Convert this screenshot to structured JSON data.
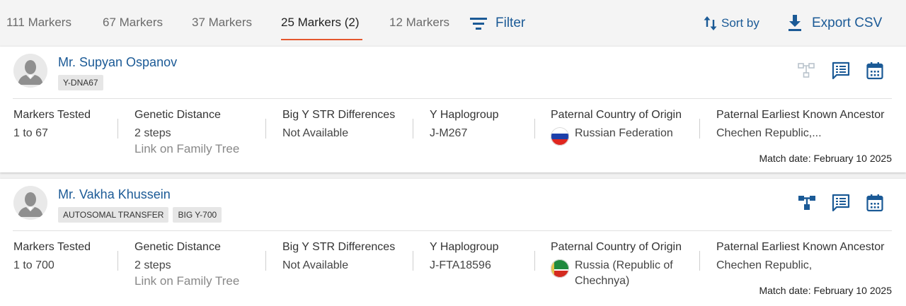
{
  "tabs": [
    {
      "label": "111 Markers"
    },
    {
      "label": "67 Markers"
    },
    {
      "label": "37 Markers"
    },
    {
      "label": "25 Markers (2)"
    },
    {
      "label": "12 Markers"
    }
  ],
  "toolbar": {
    "filter_label": "Filter",
    "sort_label": "Sort by",
    "export_label": "Export CSV"
  },
  "colors": {
    "accent": "#1b5a96",
    "tab_active_underline": "#e4572e",
    "icon_disabled": "#b9c3cc"
  },
  "matches": [
    {
      "name": "Mr. Supyan Ospanov",
      "badges": [
        "Y-DNA67"
      ],
      "tree_icon_state": "disabled",
      "columns": {
        "markers_tested": {
          "label": "Markers Tested",
          "value": "1 to 67"
        },
        "genetic_distance": {
          "label": "Genetic Distance",
          "value": "2 steps",
          "link": "Link on Family Tree"
        },
        "big_y": {
          "label": "Big Y STR Differences",
          "value": "Not Available"
        },
        "haplogroup": {
          "label": "Y Haplogroup",
          "value": "J-M267"
        },
        "country": {
          "label": "Paternal Country of Origin",
          "value": "Russian Federation",
          "flag": "russia-flag"
        },
        "ancestor": {
          "label": "Paternal Earliest Known Ancestor",
          "value": "Chechen Republic,..."
        }
      },
      "match_date": "Match date: February 10 2025"
    },
    {
      "name": "Mr. Vakha Khussein",
      "badges": [
        "AUTOSOMAL TRANSFER",
        "BIG Y-700"
      ],
      "tree_icon_state": "active",
      "columns": {
        "markers_tested": {
          "label": "Markers Tested",
          "value": "1 to 700"
        },
        "genetic_distance": {
          "label": "Genetic Distance",
          "value": "2 steps",
          "link": "Link on Family Tree"
        },
        "big_y": {
          "label": "Big Y STR Differences",
          "value": "Not Available"
        },
        "haplogroup": {
          "label": "Y Haplogroup",
          "value": "J-FTA18596"
        },
        "country": {
          "label": "Paternal Country of Origin",
          "value_line1": "Russia (Republic of",
          "value_line2": "Chechnya)",
          "flag": "chechnya-flag"
        },
        "ancestor": {
          "label": "Paternal Earliest Known Ancestor",
          "value": "Chechen Republic,"
        }
      },
      "match_date": "Match date: February 10 2025"
    }
  ]
}
